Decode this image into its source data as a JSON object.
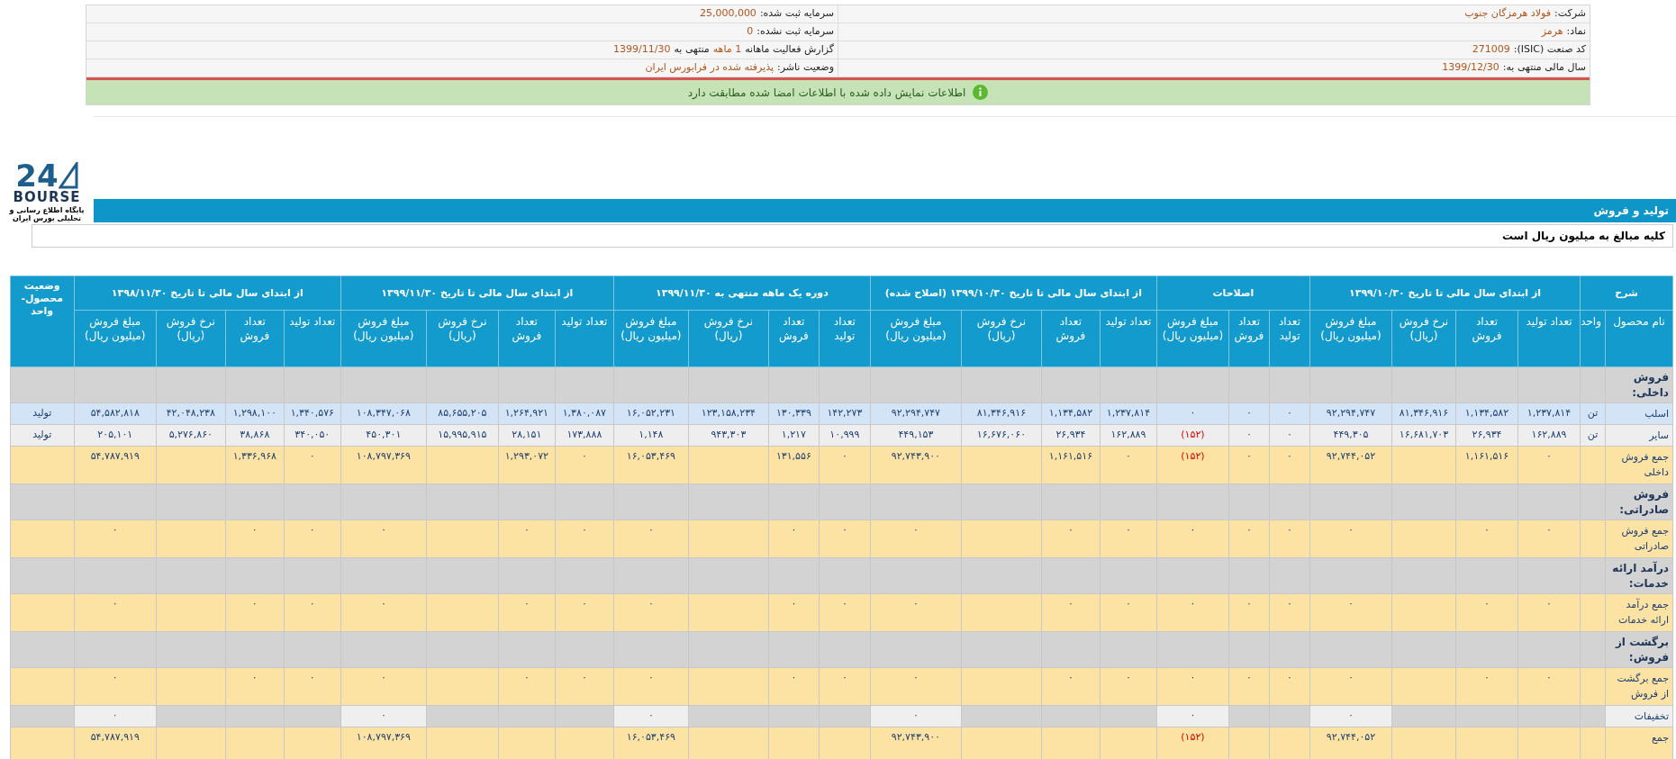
{
  "company_info": {
    "rows": [
      {
        "right": {
          "label": "شرکت:",
          "value": "فولاد هرمزگان جنوب"
        },
        "left": {
          "label": "سرمایه ثبت شده:",
          "value": "25,000,000"
        }
      },
      {
        "right": {
          "label": "نماد:",
          "value": "هرمز"
        },
        "left": {
          "label": "سرمایه ثبت نشده:",
          "value": "0"
        }
      },
      {
        "right": {
          "label": "کد صنعت (ISIC):",
          "value": "271009"
        },
        "left": {
          "label": "گزارش فعالیت ماهانه",
          "value": "1 ماهه",
          "connector": "منتهی به",
          "value_2": "1399/11/30"
        }
      },
      {
        "right": {
          "label": "سال مالی منتهی به:",
          "value": "1399/12/30"
        },
        "left": {
          "label": "وضعیت ناشر:",
          "value": "پذیرفته شده در فرابورس ایران"
        }
      }
    ]
  },
  "alert": {
    "text": "اطلاعات نمایش داده شده با اطلاعات امضا شده مطابقت دارد"
  },
  "logo": {
    "number": "24",
    "wordmark": "BOURSE",
    "tagline": "پایگاه اطلاع رسانی و تحلیلی بورس ایران"
  },
  "section_title": "تولید و فروش",
  "note": "کلیه مبالغ به میلیون ریال است",
  "table": {
    "groups": [
      {
        "label": "شرح",
        "columns": [
          "نام محصول",
          "واحد"
        ]
      },
      {
        "label": "از ابتدای سال مالی تا تاریخ ۱۳۹۹/۱۰/۳۰",
        "columns": [
          "تعداد تولید",
          "تعداد فروش",
          "نرخ فروش (ریال)",
          "مبلغ فروش (میلیون ریال)"
        ]
      },
      {
        "label": "اصلاحات",
        "columns": [
          "تعداد تولید",
          "تعداد فروش",
          "مبلغ فروش (میلیون ریال)"
        ]
      },
      {
        "label": "از ابتدای سال مالی تا تاریخ ۱۳۹۹/۱۰/۳۰ (اصلاح شده)",
        "columns": [
          "تعداد تولید",
          "تعداد فروش",
          "نرخ فروش (ریال)",
          "مبلغ فروش (میلیون ریال)"
        ]
      },
      {
        "label": "دوره یک ماهه منتهی به ۱۳۹۹/۱۱/۳۰",
        "columns": [
          "تعداد تولید",
          "تعداد فروش",
          "نرخ فروش (ریال)",
          "مبلغ فروش (میلیون ریال)"
        ]
      },
      {
        "label": "از ابتدای سال مالی تا تاریخ ۱۳۹۹/۱۱/۳۰",
        "columns": [
          "تعداد تولید",
          "تعداد فروش",
          "نرخ فروش (ریال)",
          "مبلغ فروش (میلیون ریال)"
        ]
      },
      {
        "label": "از ابتدای سال مالی تا تاریخ ۱۳۹۸/۱۱/۳۰",
        "columns": [
          "تعداد تولید",
          "تعداد فروش",
          "نرخ فروش (ریال)",
          "مبلغ فروش (میلیون ریال)"
        ]
      },
      {
        "label": "وضعیت محصول-واحد"
      }
    ],
    "rows": [
      {
        "kind": "section",
        "label": "فروش داخلی:"
      },
      {
        "kind": "item",
        "label": "اسلب",
        "highlighted": true,
        "cells": [
          "تن",
          "۱,۲۳۷,۸۱۴",
          "۱,۱۳۴,۵۸۲",
          "۸۱,۳۴۶,۹۱۶",
          "۹۲,۲۹۴,۷۴۷",
          "۰",
          "۰",
          "۰",
          "۱,۲۳۷,۸۱۴",
          "۱,۱۳۴,۵۸۲",
          "۸۱,۳۴۶,۹۱۶",
          "۹۲,۲۹۴,۷۴۷",
          "۱۴۲,۲۷۳",
          "۱۳۰,۳۳۹",
          "۱۲۳,۱۵۸,۲۳۴",
          "۱۶,۰۵۲,۲۳۱",
          "۱,۳۸۰,۰۸۷",
          "۱,۲۶۴,۹۲۱",
          "۸۵,۶۵۵,۲۰۵",
          "۱۰۸,۳۴۷,۰۶۸",
          "۱,۳۴۰,۵۷۶",
          "۱,۲۹۸,۱۰۰",
          "۴۲,۰۴۸,۲۳۸",
          "۵۴,۵۸۲,۸۱۸",
          "تولید"
        ]
      },
      {
        "kind": "item",
        "label": "سایر",
        "highlighted": false,
        "cells": [
          "تن",
          "۱۶۲,۸۸۹",
          "۲۶,۹۳۴",
          "۱۶,۶۸۱,۷۰۳",
          "۴۴۹,۳۰۵",
          "۰",
          "۰",
          {
            "text": "(۱۵۲)",
            "negative": true
          },
          "۱۶۲,۸۸۹",
          "۲۶,۹۳۴",
          "۱۶,۶۷۶,۰۶۰",
          "۴۴۹,۱۵۳",
          "۱۰,۹۹۹",
          "۱,۲۱۷",
          "۹۴۳,۳۰۳",
          "۱,۱۴۸",
          "۱۷۳,۸۸۸",
          "۲۸,۱۵۱",
          "۱۵,۹۹۵,۹۱۵",
          "۴۵۰,۳۰۱",
          "۳۴۰,۰۵۰",
          "۳۸,۸۶۸",
          "۵,۲۷۶,۸۶۰",
          "۲۰۵,۱۰۱",
          "تولید"
        ]
      },
      {
        "kind": "total",
        "label": "جمع فروش داخلی",
        "cells": [
          null,
          "۰",
          "۱,۱۶۱,۵۱۶",
          null,
          "۹۲,۷۴۴,۰۵۲",
          "۰",
          "۰",
          {
            "text": "(۱۵۲)",
            "negative": true
          },
          "۰",
          "۱,۱۶۱,۵۱۶",
          null,
          "۹۲,۷۴۳,۹۰۰",
          "۰",
          "۱۳۱,۵۵۶",
          null,
          "۱۶,۰۵۳,۴۶۹",
          "۰",
          "۱,۲۹۳,۰۷۲",
          null,
          "۱۰۸,۷۹۷,۳۶۹",
          "۰",
          "۱,۳۳۶,۹۶۸",
          null,
          "۵۴,۷۸۷,۹۱۹",
          null
        ]
      },
      {
        "kind": "section",
        "label": "فروش صادراتی:"
      },
      {
        "kind": "total",
        "label": "جمع فروش صادراتی",
        "cells": [
          null,
          "۰",
          "۰",
          null,
          "۰",
          "۰",
          "۰",
          "۰",
          "۰",
          "۰",
          null,
          "۰",
          "۰",
          "۰",
          null,
          "۰",
          "۰",
          "۰",
          null,
          "۰",
          "۰",
          "۰",
          null,
          "۰",
          null
        ]
      },
      {
        "kind": "section",
        "label": "درآمد ارائه خدمات:"
      },
      {
        "kind": "total",
        "label": "جمع درآمد ارائه خدمات",
        "cells": [
          null,
          "۰",
          "۰",
          null,
          "۰",
          "۰",
          "۰",
          "۰",
          "۰",
          "۰",
          null,
          "۰",
          "۰",
          "۰",
          null,
          "۰",
          "۰",
          "۰",
          null,
          "۰",
          "۰",
          "۰",
          null,
          "۰",
          null
        ]
      },
      {
        "kind": "section",
        "label": "برگشت از فروش:"
      },
      {
        "kind": "total",
        "label": "جمع برگشت از فروش",
        "cells": [
          null,
          "۰",
          "۰",
          null,
          "۰",
          "۰",
          "۰",
          "۰",
          "۰",
          "۰",
          null,
          "۰",
          "۰",
          "۰",
          null,
          "۰",
          "۰",
          "۰",
          null,
          "۰",
          "۰",
          "۰",
          null,
          "۰",
          null
        ]
      },
      {
        "kind": "discount",
        "label": "تخفیفات",
        "cells": [
          null,
          null,
          null,
          null,
          "۰",
          null,
          null,
          "۰",
          null,
          null,
          null,
          "۰",
          null,
          null,
          null,
          "۰",
          null,
          null,
          null,
          "۰",
          null,
          null,
          null,
          "۰",
          null
        ]
      },
      {
        "kind": "total",
        "label": "جمع",
        "cells": [
          null,
          null,
          null,
          null,
          "۹۲,۷۴۴,۰۵۲",
          null,
          null,
          {
            "text": "(۱۵۲)",
            "negative": true
          },
          null,
          null,
          null,
          "۹۲,۷۴۳,۹۰۰",
          null,
          null,
          null,
          "۱۶,۰۵۳,۴۶۹",
          null,
          null,
          null,
          "۱۰۸,۷۹۷,۳۶۹",
          null,
          null,
          null,
          "۵۴,۷۸۷,۹۱۹",
          null
        ]
      }
    ]
  }
}
